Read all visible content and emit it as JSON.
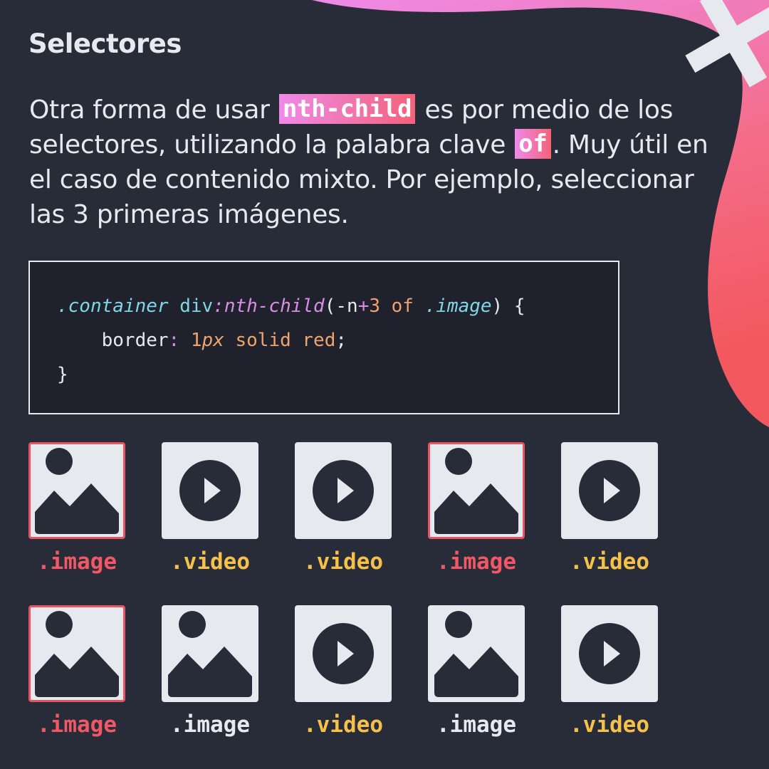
{
  "title": "Selectores",
  "paragraph": {
    "part1": "Otra forma de usar ",
    "kw1": "nth-child",
    "part2": " es por medio de los selectores, utilizando la palabra clave ",
    "kw2": "of",
    "part3": ". Muy útil en el caso de contenido mixto. Por ejemplo, seleccionar las 3 primeras imágenes."
  },
  "code": {
    "selector_class": ".container",
    "selector_tag": "div",
    "pseudo": ":nth-child",
    "open_paren": "(",
    "formula_n": "-n",
    "formula_plus": "+",
    "formula_num": "3",
    "of_kw": "of",
    "of_class": ".image",
    "close_paren": ")",
    "open_brace": "{",
    "property": "border",
    "colon": ":",
    "value_num": "1",
    "value_unit": "px",
    "value_rest": "solid red",
    "semicolon": ";",
    "close_brace": "}"
  },
  "colors": {
    "background": "#282b38",
    "selected_border": "#e85560",
    "selected_label": "#ef5864",
    "video_label": "#f5c14b",
    "image_label": "#e6e9ee",
    "gradient_start": "#ee8ae8",
    "gradient_end": "#f4627a"
  },
  "items": [
    {
      "type": "image",
      "label": ".image",
      "selected": true,
      "icon": "image-icon"
    },
    {
      "type": "video",
      "label": ".video",
      "selected": false,
      "icon": "play-icon"
    },
    {
      "type": "video",
      "label": ".video",
      "selected": false,
      "icon": "play-icon"
    },
    {
      "type": "image",
      "label": ".image",
      "selected": true,
      "icon": "image-icon"
    },
    {
      "type": "video",
      "label": ".video",
      "selected": false,
      "icon": "play-icon"
    },
    {
      "type": "image",
      "label": ".image",
      "selected": true,
      "icon": "image-icon"
    },
    {
      "type": "image",
      "label": ".image",
      "selected": false,
      "icon": "image-icon"
    },
    {
      "type": "video",
      "label": ".video",
      "selected": false,
      "icon": "play-icon"
    },
    {
      "type": "image",
      "label": ".image",
      "selected": false,
      "icon": "image-icon"
    },
    {
      "type": "video",
      "label": ".video",
      "selected": false,
      "icon": "play-icon"
    }
  ]
}
